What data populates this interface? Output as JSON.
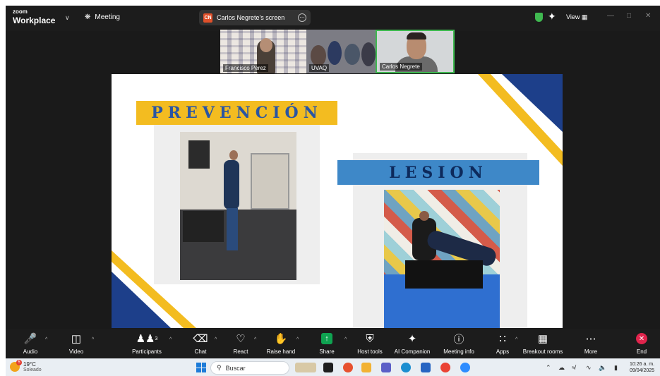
{
  "app": {
    "brand_small": "zoom",
    "brand_name": "Workplace"
  },
  "header": {
    "meeting_label": "Meeting",
    "share_badge": "CN",
    "share_title": "Carlos Negrete's screen",
    "view_label": "View"
  },
  "participants": [
    {
      "name": "Francisco Perez"
    },
    {
      "name": "UVAQ"
    },
    {
      "name": "Carlos Negrete"
    }
  ],
  "slide": {
    "prevention_title": "PREVENCIÓN",
    "injury_title": "LESION",
    "colors": {
      "yellow": "#f3bc20",
      "blue": "#3e88c8",
      "navy": "#1d3f8a"
    }
  },
  "toolbar": {
    "audio": "Audio",
    "video": "Video",
    "participants": "Participants",
    "participants_count": "3",
    "chat": "Chat",
    "react": "React",
    "raise_hand": "Raise hand",
    "share": "Share",
    "host_tools": "Host tools",
    "ai_companion": "AI Companion",
    "meeting_info": "Meeting info",
    "apps": "Apps",
    "breakout_rooms": "Breakout rooms",
    "more": "More",
    "end": "End"
  },
  "taskbar": {
    "temperature": "19°C",
    "condition": "Soleado",
    "weather_badge": "5",
    "search_placeholder": "Buscar",
    "time": "10:26 a. m.",
    "date": "09/04/2025"
  }
}
